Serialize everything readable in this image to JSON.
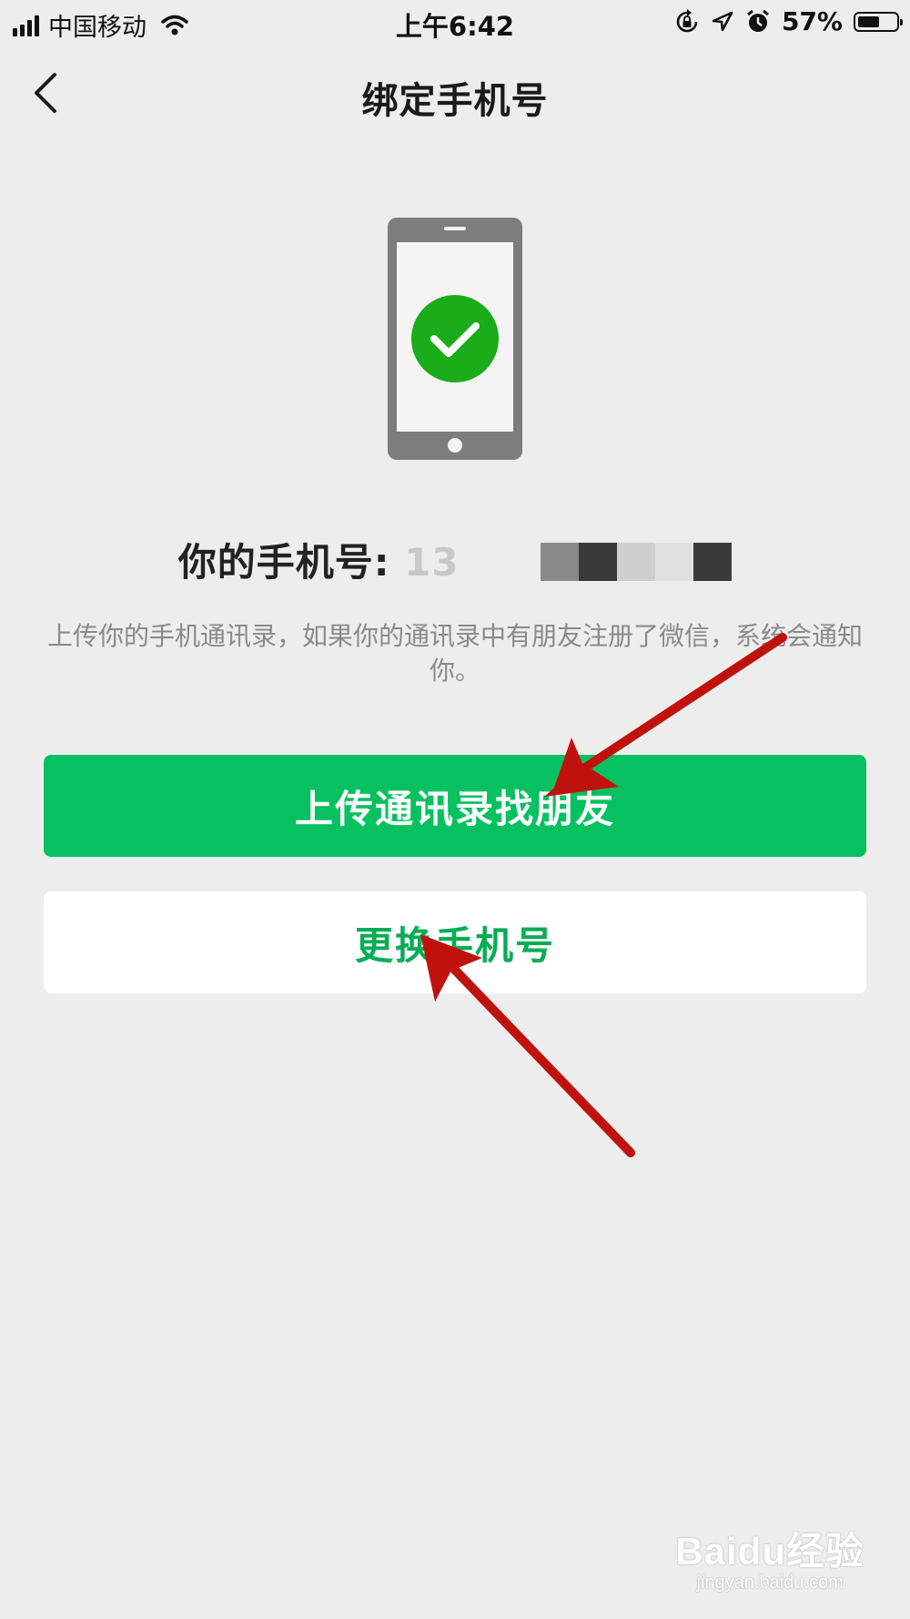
{
  "status_bar": {
    "carrier": "中国移动",
    "time": "上午6:42",
    "battery_percent": "57%",
    "battery_level": 0.57
  },
  "nav": {
    "title": "绑定手机号",
    "back_icon": "chevron-left-icon"
  },
  "bound_phone": {
    "label": "你的手机号:",
    "number_visible_prefix": "13"
  },
  "description": "上传你的手机通讯录，如果你的通讯录中有朋友注册了微信，系统会通知你。",
  "buttons": {
    "upload_contacts": "上传通讯录找朋友",
    "change_phone": "更换手机号"
  },
  "watermark": {
    "brand": "Baidu经验",
    "url": "jingyan.baidu.com"
  },
  "colors": {
    "primary_green": "#07c160",
    "annotation_arrow": "#c0120c",
    "background": "#ededed"
  }
}
